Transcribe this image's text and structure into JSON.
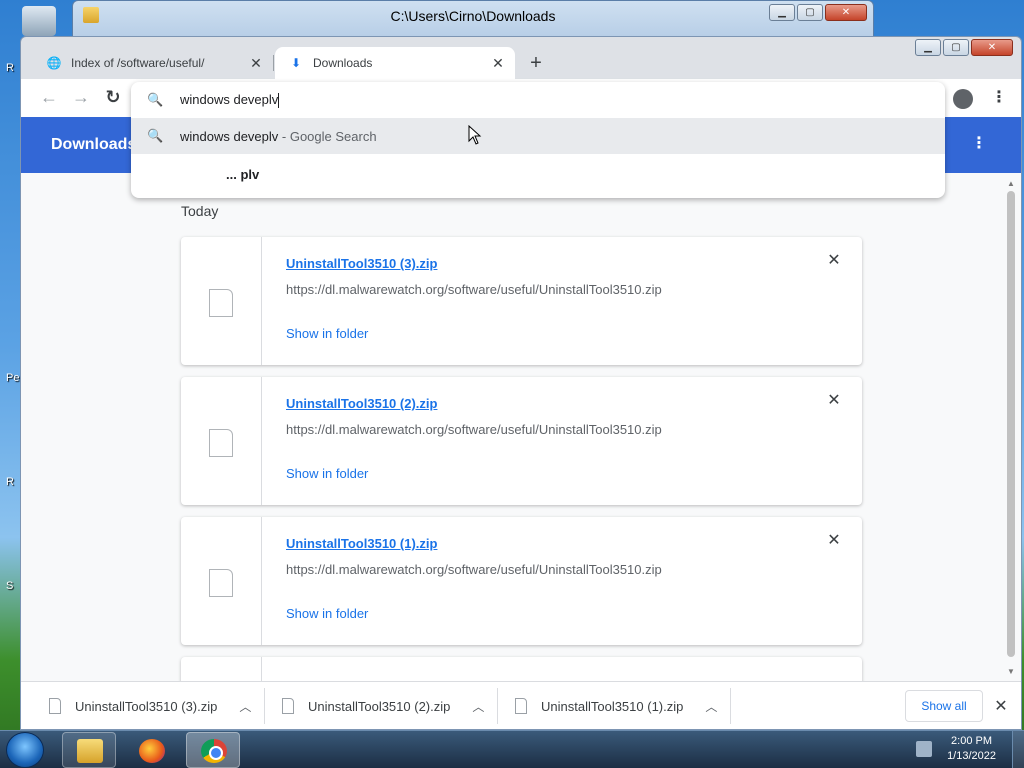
{
  "desktop": {
    "labels": [
      "R",
      "Pe",
      "R",
      "S"
    ]
  },
  "explorer": {
    "title": "C:\\Users\\Cirno\\Downloads"
  },
  "chrome": {
    "tabs": [
      {
        "label": "Index of /software/useful/",
        "icon": "globe-icon"
      },
      {
        "label": "Downloads",
        "icon": "download-icon"
      }
    ],
    "omnibox": {
      "input_value": "windows deveplv",
      "suggestion_query": "windows deveplv",
      "suggestion_suffix": " - Google Search",
      "more_label": "... plv"
    }
  },
  "downloads_page": {
    "title": "Downloads",
    "section": "Today",
    "items": [
      {
        "name": "UninstallTool3510 (3).zip",
        "url": "https://dl.malwarewatch.org/software/useful/UninstallTool3510.zip",
        "action": "Show in folder"
      },
      {
        "name": "UninstallTool3510 (2).zip",
        "url": "https://dl.malwarewatch.org/software/useful/UninstallTool3510.zip",
        "action": "Show in folder"
      },
      {
        "name": "UninstallTool3510 (1).zip",
        "url": "https://dl.malwarewatch.org/software/useful/UninstallTool3510.zip",
        "action": "Show in folder"
      }
    ]
  },
  "shelf": {
    "items": [
      "UninstallTool3510 (3).zip",
      "UninstallTool3510 (2).zip",
      "UninstallTool3510 (1).zip"
    ],
    "show_all": "Show all"
  },
  "taskbar": {
    "time": "2:00 PM",
    "date": "1/13/2022"
  },
  "colors": {
    "chrome_accent": "#3367d6",
    "link": "#1a73e8"
  }
}
